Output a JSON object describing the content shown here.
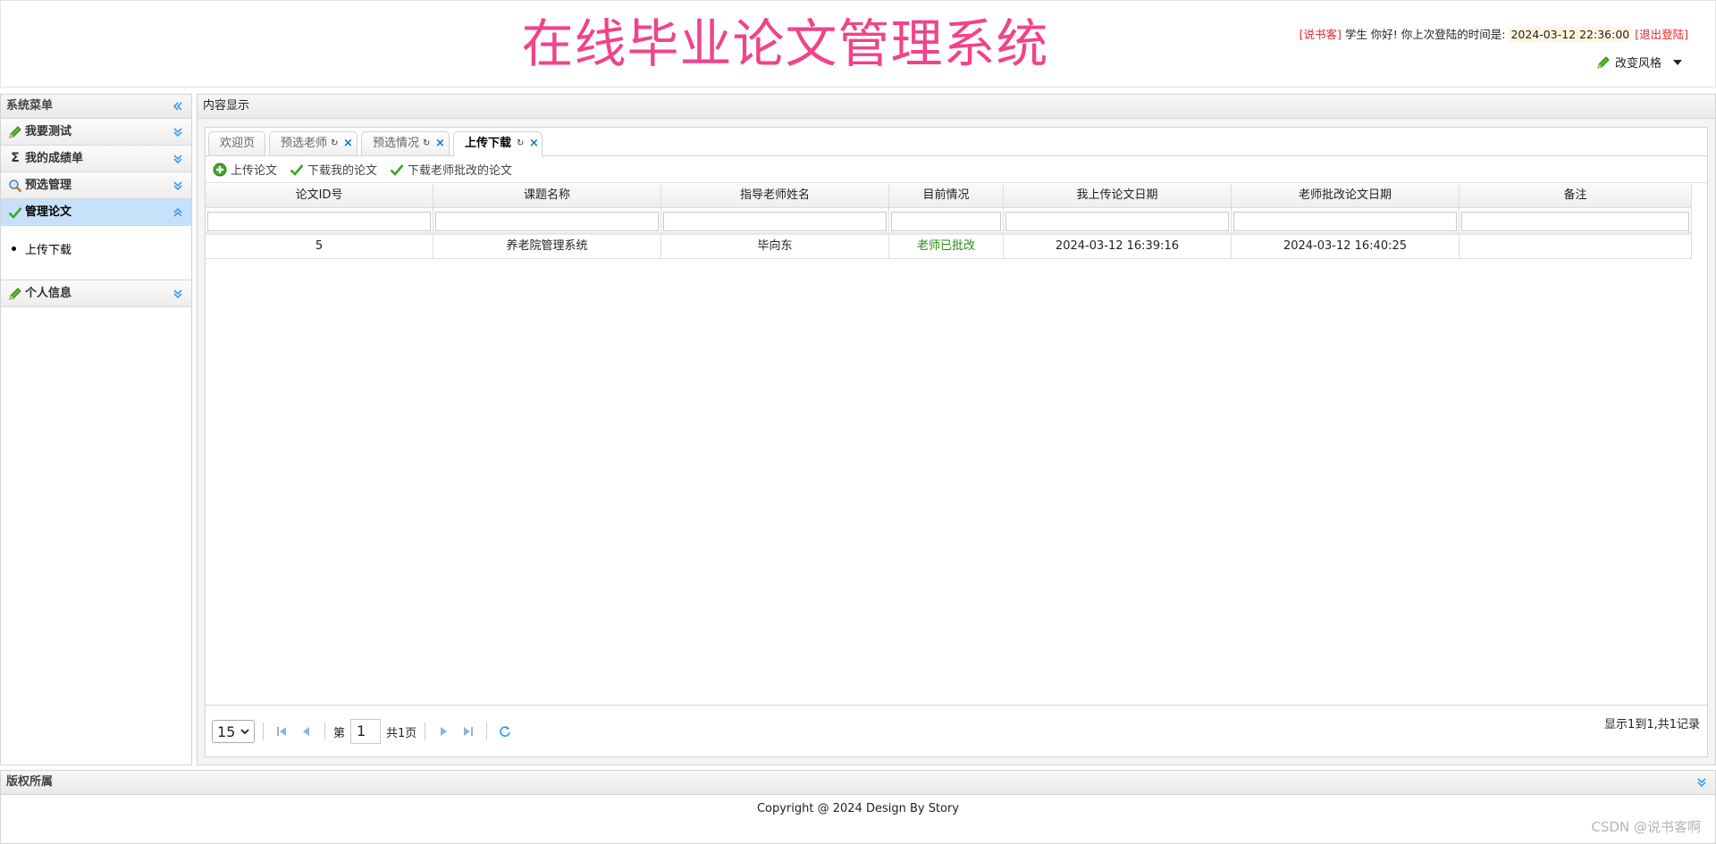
{
  "header": {
    "title": "在线毕业论文管理系统",
    "user_tag": "[说书客]",
    "greeting": "学生 你好! 你上次登陆的时间是:",
    "last_login": "2024-03-12 22:36:00",
    "logout": "[退出登陆]",
    "change_style": "改变风格"
  },
  "sidebar": {
    "title": "系统菜单",
    "items": [
      {
        "label": "我要测试",
        "icon": "pencil-icon"
      },
      {
        "label": "我的成绩单",
        "icon": "sigma-icon"
      },
      {
        "label": "预选管理",
        "icon": "magnifier-icon"
      },
      {
        "label": "管理论文",
        "icon": "checkmark-icon",
        "active": true
      },
      {
        "label": "个人信息",
        "icon": "pencil-icon"
      }
    ],
    "submenu": [
      "上传下载"
    ]
  },
  "content": {
    "title": "内容显示",
    "tabs": [
      {
        "label": "欢迎页"
      },
      {
        "label": "预选老师"
      },
      {
        "label": "预选情况"
      },
      {
        "label": "上传下载",
        "active": true
      }
    ],
    "toolbar": {
      "upload": "上传论文",
      "download_mine": "下载我的论文",
      "download_reviewed": "下载老师批改的论文"
    },
    "table": {
      "columns": [
        "论文ID号",
        "课题名称",
        "指导老师姓名",
        "目前情况",
        "我上传论文日期",
        "老师批改论文日期",
        "备注"
      ],
      "rows": [
        [
          "5",
          "养老院管理系统",
          "毕向东",
          "老师已批改",
          "2024-03-12 16:39:16",
          "2024-03-12 16:40:25",
          ""
        ]
      ]
    },
    "pager": {
      "page_size": "15",
      "page_prefix": "第",
      "page_number": "1",
      "page_total": "共1页",
      "summary": "显示1到1,共1记录"
    }
  },
  "footer": {
    "title": "版权所属",
    "copyright": "Copyright @ 2024 Design By Story",
    "watermark": "CSDN @说书客啊"
  },
  "colors": {
    "title": "#f0438c",
    "accent_blue": "#3a9ee6",
    "active_menu": "#c8e1fb",
    "status_green": "#2a8a14",
    "user_red": "#e3282e"
  }
}
